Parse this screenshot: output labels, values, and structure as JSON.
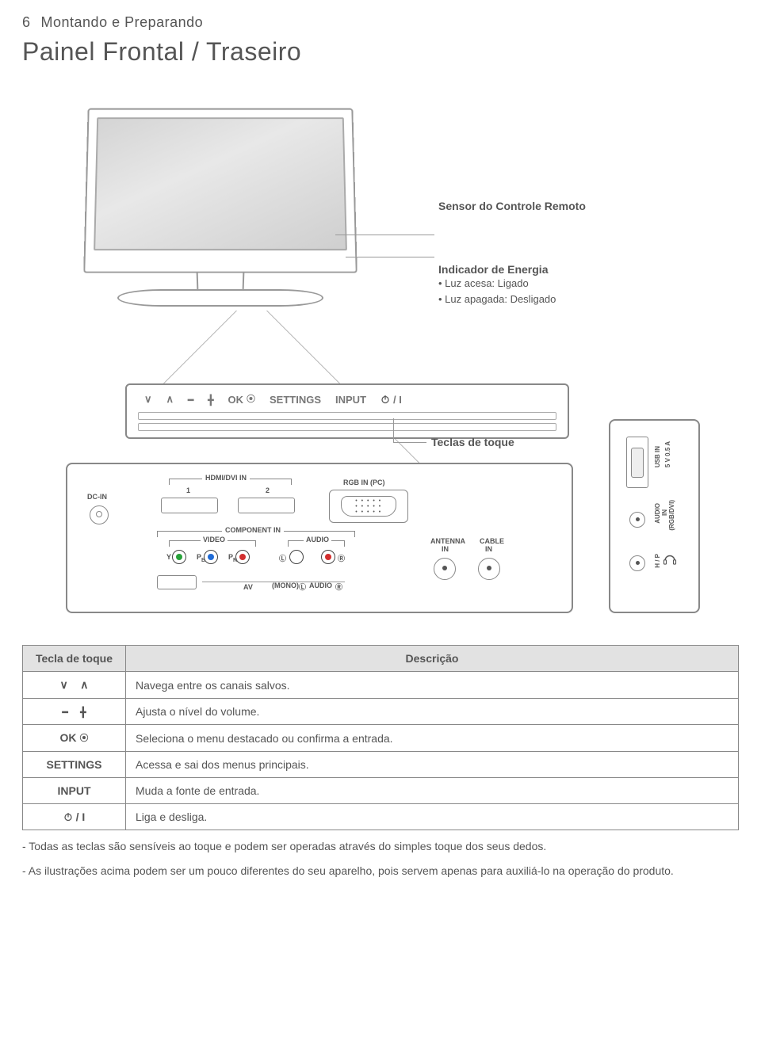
{
  "page_number": "6",
  "section": "Montando e Preparando",
  "title": "Painel Frontal / Traseiro",
  "callouts": {
    "remote_sensor": "Sensor do Controle Remoto",
    "energy_indicator_title": "Indicador de Energia",
    "energy_on": "• Luz acesa: Ligado",
    "energy_off": "• Luz apagada: Desligado",
    "touch_keys": "Teclas de toque"
  },
  "button_strip": {
    "ok": "OK",
    "settings": "SETTINGS",
    "input": "INPUT",
    "power_suffix": "/ I"
  },
  "ports": {
    "dc_in": "DC-IN",
    "hdmi_dvi_in": "HDMI/DVI IN",
    "hdmi1": "1",
    "hdmi2": "2",
    "rgb_in": "RGB IN (PC)",
    "component_in": "COMPONENT IN",
    "component_video": "VIDEO",
    "component_audio": "AUDIO",
    "y": "Y",
    "pb": "P",
    "pb_sub": "B",
    "pr": "P",
    "pr_sub": "R",
    "l": "L",
    "r": "R",
    "video": "VIDEO",
    "av": "AV",
    "mono": "(MONO)",
    "audio": "AUDIO",
    "antenna_in_top": "ANTENNA",
    "antenna_in_bot": "IN",
    "cable_in_top": "CABLE",
    "cable_in_bot": "IN",
    "usb_in": "USB IN",
    "usb_spec": "5 V    0.5 A",
    "audio_in": "AUDIO",
    "audio_in2": "IN",
    "audio_in3": "(RGB/DVI)",
    "hp": "H / P"
  },
  "table": {
    "header_key": "Tecla de toque",
    "header_desc": "Descrição",
    "rows": {
      "nav": "Navega entre os canais salvos.",
      "vol": "Ajusta o nível do volume.",
      "ok": "Seleciona o menu destacado ou confirma a entrada.",
      "settings": "Acessa e sai dos menus principais.",
      "input": "Muda a fonte de entrada.",
      "power": "Liga e desliga."
    },
    "ok_label": "OK",
    "settings_label": "SETTINGS",
    "input_label": "INPUT",
    "power_suffix": "/ I"
  },
  "notes": {
    "note1": "- Todas as teclas são sensíveis ao toque e podem ser operadas através do simples toque dos seus dedos.",
    "note2": "- As ilustrações acima podem ser um pouco diferentes do seu aparelho, pois servem  apenas para auxiliá-lo na operação do produto."
  }
}
